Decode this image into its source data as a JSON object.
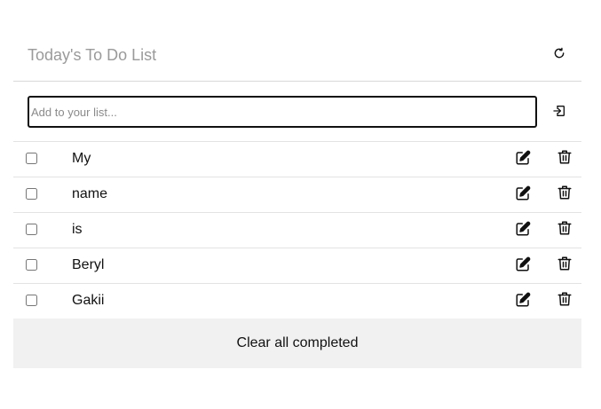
{
  "header": {
    "title": "Today's To Do List",
    "refresh_icon": "refresh-icon"
  },
  "add_item": {
    "placeholder": "Add to your list...",
    "value": "",
    "submit_icon": "enter-icon"
  },
  "todos": [
    {
      "text": "My",
      "completed": false
    },
    {
      "text": "name",
      "completed": false
    },
    {
      "text": "is",
      "completed": false
    },
    {
      "text": "Beryl",
      "completed": false
    },
    {
      "text": "Gakii",
      "completed": false
    }
  ],
  "item_icons": {
    "edit": "edit-icon",
    "delete": "trash-icon"
  },
  "footer": {
    "clear_label": "Clear all completed"
  },
  "colors": {
    "title": "#9a9a9a",
    "text": "#111111",
    "divider": "#e3e3e3",
    "footer_bg": "#f1f1f1"
  }
}
